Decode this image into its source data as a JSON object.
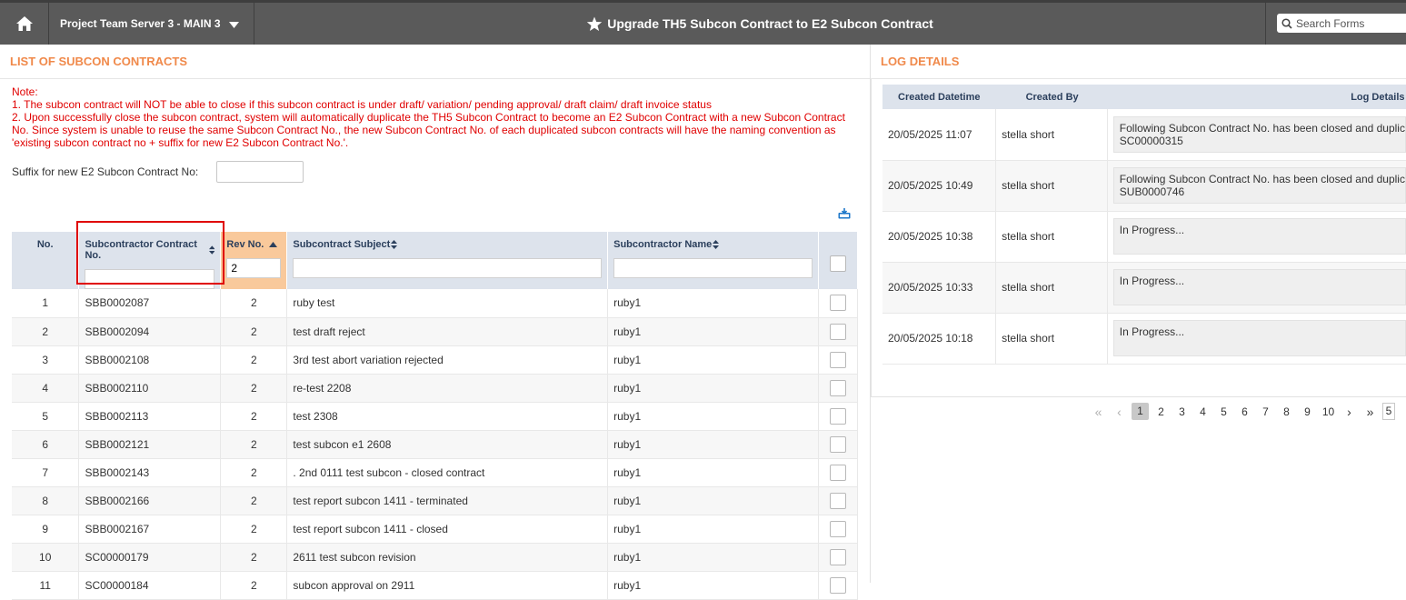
{
  "topbar": {
    "project": "Project Team Server 3 - MAIN 3",
    "title": "Upgrade TH5 Subcon Contract to E2 Subcon Contract",
    "search_placeholder": "Search Forms"
  },
  "left": {
    "heading": "LIST OF SUBCON CONTRACTS",
    "note_title": "Note:",
    "note_1": "1. The subcon contract will NOT be able to close if this subcon contract is under draft/ variation/ pending approval/ draft claim/ draft invoice status",
    "note_2": "2. Upon successfully close the subcon contract, system will automatically duplicate the TH5 Subcon Contract to become an E2 Subcon Contract with a new Subcon Contract No. Since system is unable to reuse the same Subcon Contract No., the new Subcon Contract No. of each duplicated subcon contracts will have the naming convention as 'existing subcon contract no + suffix for new E2 Subcon Contract No.'.",
    "suffix_label": "Suffix for new E2 Subcon Contract No:",
    "suffix_value": "",
    "columns": {
      "no": "No.",
      "contract_no": "Subcontractor Contract No.",
      "rev_no": "Rev No.",
      "subject": "Subcontract Subject",
      "name": "Subcontractor Name"
    },
    "filters": {
      "contract_no": "",
      "rev_no": "2",
      "subject": "",
      "name": ""
    },
    "rows": [
      {
        "no": "1",
        "contract_no": "SBB0002087",
        "rev": "2",
        "subject": "ruby test",
        "name": "ruby1"
      },
      {
        "no": "2",
        "contract_no": "SBB0002094",
        "rev": "2",
        "subject": "test draft reject",
        "name": "ruby1"
      },
      {
        "no": "3",
        "contract_no": "SBB0002108",
        "rev": "2",
        "subject": "3rd test abort variation rejected",
        "name": "ruby1"
      },
      {
        "no": "4",
        "contract_no": "SBB0002110",
        "rev": "2",
        "subject": "re-test 2208",
        "name": "ruby1"
      },
      {
        "no": "5",
        "contract_no": "SBB0002113",
        "rev": "2",
        "subject": "test 2308",
        "name": "ruby1"
      },
      {
        "no": "6",
        "contract_no": "SBB0002121",
        "rev": "2",
        "subject": "test subcon e1 2608",
        "name": "ruby1"
      },
      {
        "no": "7",
        "contract_no": "SBB0002143",
        "rev": "2",
        "subject": ". 2nd 0111 test subcon - closed contract",
        "name": "ruby1"
      },
      {
        "no": "8",
        "contract_no": "SBB0002166",
        "rev": "2",
        "subject": "test report subcon 1411 - terminated",
        "name": "ruby1"
      },
      {
        "no": "9",
        "contract_no": "SBB0002167",
        "rev": "2",
        "subject": "test report subcon 1411 - closed",
        "name": "ruby1"
      },
      {
        "no": "10",
        "contract_no": "SC00000179",
        "rev": "2",
        "subject": "2611 test subcon revision",
        "name": "ruby1"
      },
      {
        "no": "11",
        "contract_no": "SC00000184",
        "rev": "2",
        "subject": "subcon approval on 2911",
        "name": "ruby1"
      }
    ]
  },
  "right": {
    "heading": "LOG DETAILS",
    "columns": {
      "created": "Created Datetime",
      "by": "Created By",
      "details": "Log Details"
    },
    "rows": [
      {
        "created": "20/05/2025 11:07",
        "by": "stella short",
        "details_1": "Following Subcon Contract No. has been closed and duplic",
        "details_2": "SC00000315"
      },
      {
        "created": "20/05/2025 10:49",
        "by": "stella short",
        "details_1": "Following Subcon Contract No. has been closed and duplic",
        "details_2": "SUB0000746"
      },
      {
        "created": "20/05/2025 10:38",
        "by": "stella short",
        "details_1": "In Progress...",
        "details_2": ""
      },
      {
        "created": "20/05/2025 10:33",
        "by": "stella short",
        "details_1": "In Progress...",
        "details_2": ""
      },
      {
        "created": "20/05/2025 10:18",
        "by": "stella short",
        "details_1": "In Progress...",
        "details_2": ""
      }
    ],
    "pager": {
      "pages": [
        "1",
        "2",
        "3",
        "4",
        "5",
        "6",
        "7",
        "8",
        "9",
        "10"
      ],
      "active": "1",
      "page_size": "5"
    }
  },
  "colors": {
    "topbar": "#5a5a5a",
    "heading": "#f0894a",
    "note": "#e00000",
    "header_bg": "#dde3ec",
    "sorted_header": "#f9c99b",
    "highlight": "#e00000"
  },
  "icons": {
    "home": "home-icon",
    "caret": "caret-down-icon",
    "star": "star-icon",
    "search": "search-icon",
    "export": "export-icon",
    "sort": "sort-icon",
    "sort_asc": "sort-asc-icon"
  }
}
